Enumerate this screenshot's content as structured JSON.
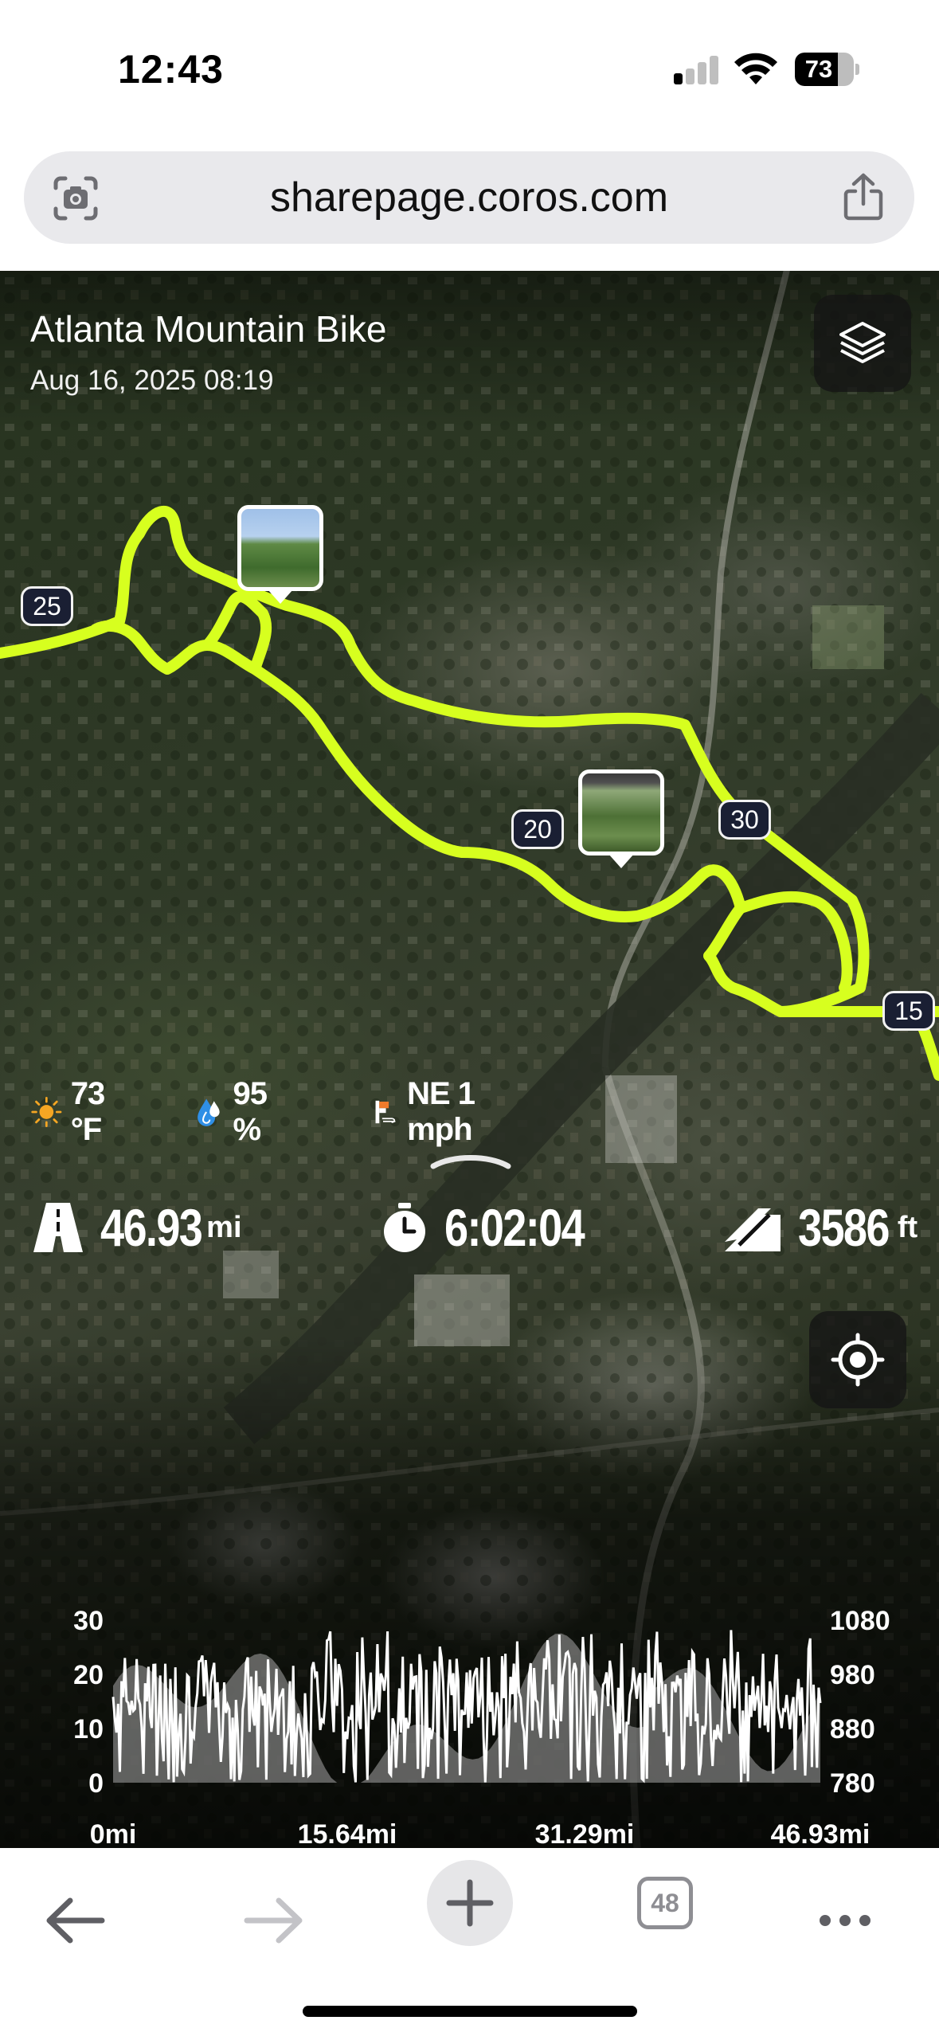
{
  "status_bar": {
    "time": "12:43",
    "battery_level": "73",
    "battery_fraction": 0.73
  },
  "browser": {
    "url": "sharepage.coros.com",
    "tabs_count": "48"
  },
  "activity": {
    "title": "Atlanta Mountain Bike",
    "date": "Aug 16, 2025 08:19"
  },
  "map": {
    "route_color": "#d7ff1f",
    "mile_markers": [
      {
        "label": "25"
      },
      {
        "label": "20"
      },
      {
        "label": "30"
      },
      {
        "label": "15"
      }
    ]
  },
  "weather": {
    "temperature": "73 °F",
    "humidity": "95 %",
    "wind": "NE 1 mph"
  },
  "stats": {
    "distance_value": "46.93",
    "distance_unit": "mi",
    "time_value": "6:02:04",
    "elevation_value": "3586",
    "elevation_unit": "ft"
  },
  "chart_data": {
    "type": "area",
    "x_ticks": [
      "0mi",
      "15.64mi",
      "31.29mi",
      "46.93mi"
    ],
    "xlim": [
      0,
      46.93
    ],
    "y_left_ticks": [
      "30",
      "20",
      "10",
      "0"
    ],
    "ylim_left": [
      0,
      30
    ],
    "y_right_ticks": [
      "1080",
      "980",
      "880",
      "780"
    ],
    "ylim_right": [
      780,
      1080
    ],
    "speed_color": "#ffffff",
    "elevation_color": "#9a9a9a"
  },
  "icons": {
    "layers": "layers-icon",
    "locate": "locate-icon",
    "sun": "sun-icon",
    "humidity": "water-drop-icon",
    "wind": "wind-icon",
    "distance": "road-icon",
    "time": "stopwatch-icon",
    "elevation": "elevation-icon"
  }
}
